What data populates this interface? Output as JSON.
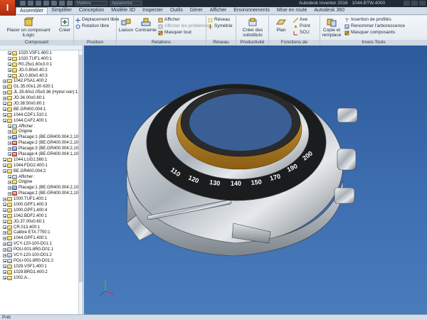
{
  "app": {
    "title_app": "Autodesk Inventor 2016",
    "title_file": "1044.BTW.4000"
  },
  "qat": {
    "material": "Matière",
    "appearance": "Apparence"
  },
  "tabs": [
    "Assembler",
    "Simplifier",
    "Conception",
    "Modèle 3D",
    "Inspecter",
    "Outils",
    "Gérer",
    "Afficher",
    "Environnements",
    "Mise en route",
    "Autodesk 360"
  ],
  "ribbon": {
    "composant": {
      "title": "Composant",
      "place": "Placer un composant iLogic",
      "create": "Créer"
    },
    "position": {
      "title": "Position",
      "free_move": "Déplacement libre",
      "free_rotate": "Rotation libre"
    },
    "relations": {
      "title": "Relations",
      "joint": "Liaison",
      "constraint": "Contrainte",
      "show": "Afficher",
      "show_problems": "Afficher les problèmes",
      "hide_all": "Masquer tout"
    },
    "reseau": {
      "title": "Réseau",
      "pattern": "Réseau",
      "mirror": "Symétrie"
    },
    "productivite": {
      "title": "Productivité",
      "substitutes": "Créer des substituts"
    },
    "fonctions": {
      "title": "Fonctions de construction",
      "plane": "Plan",
      "axis": "Axe",
      "point": "Point",
      "ucs": "SCU"
    },
    "inven_tools": {
      "title": "Inven-Tools",
      "copy_replace": "Copie et remplace",
      "insert_profiles": "Insertion de profilés",
      "rename_tree": "Renommer l'arborescence",
      "hide_components": "Masquer composants"
    }
  },
  "tree": [
    {
      "label": "1020.VSF1.400:1",
      "depth": 1,
      "icon": "yellow"
    },
    {
      "label": "1020.TUF1.400:1",
      "depth": 1,
      "icon": "yellow"
    },
    {
      "label": "R0.25x1.60x3.0:1",
      "depth": 1,
      "icon": "yellow"
    },
    {
      "label": "JO.0.80x0.40:2",
      "depth": 1,
      "icon": "yellow"
    },
    {
      "label": "JO.0.80x0.40:3",
      "depth": 1,
      "icon": "yellow"
    },
    {
      "label": "1042.PSA1.400:2",
      "depth": 0,
      "icon": "yellow"
    },
    {
      "label": "GL.35.00x1.20-920:1",
      "depth": 0,
      "icon": "yellow"
    },
    {
      "label": "JL.35.60x1.05x0.36 (Hytrel noir):1",
      "depth": 0,
      "icon": "yellow"
    },
    {
      "label": "JO.34.00x0.80:1",
      "depth": 0,
      "icon": "yellow"
    },
    {
      "label": "JO.38.50x0.80:1",
      "depth": 0,
      "icon": "yellow"
    },
    {
      "label": "BE.GR400.004:1",
      "depth": 0,
      "icon": "yellow"
    },
    {
      "label": "1044.CDF1.510:1",
      "depth": 0,
      "icon": "yellow"
    },
    {
      "label": "1044.CAF2.400:1",
      "depth": 0,
      "icon": "yellow"
    },
    {
      "label": "Afficher :",
      "depth": 1,
      "icon": "gray"
    },
    {
      "label": "Origine",
      "depth": 1,
      "icon": "yellow"
    },
    {
      "label": "Placage:1 (BE.GR400.004:2,1044",
      "depth": 1,
      "icon": "blue"
    },
    {
      "label": "Placage:2 (BE.GR400.004:2,1044",
      "depth": 1,
      "icon": "red"
    },
    {
      "label": "Placage:3 (BE.GR400.004:2,1044",
      "depth": 1,
      "icon": "blue"
    },
    {
      "label": "Placage:4 (BE.GR400.004:1,1044",
      "depth": 1,
      "icon": "red"
    },
    {
      "label": "1044.LUG1.560:1",
      "depth": 0,
      "icon": "yellow"
    },
    {
      "label": "1044.FDG2.400:1",
      "depth": 0,
      "icon": "yellow"
    },
    {
      "label": "BE.GR400.004:2",
      "depth": 0,
      "icon": "yellow"
    },
    {
      "label": "Afficher :",
      "depth": 1,
      "icon": "gray"
    },
    {
      "label": "Origine",
      "depth": 1,
      "icon": "yellow"
    },
    {
      "label": "Placage:1 (BE.GR400.004:2,104",
      "depth": 1,
      "icon": "blue"
    },
    {
      "label": "Placage:2 (BE.GR400.004:2,104",
      "depth": 1,
      "icon": "red"
    },
    {
      "label": "1000.TUF1.400:1",
      "depth": 0,
      "icon": "yellow"
    },
    {
      "label": "1000.GPF1.400:3",
      "depth": 0,
      "icon": "yellow"
    },
    {
      "label": "1000.GPF1.400:4",
      "depth": 0,
      "icon": "yellow"
    },
    {
      "label": "1042.BDF2.400:1",
      "depth": 0,
      "icon": "yellow"
    },
    {
      "label": "JO.37.00x0.60:1",
      "depth": 0,
      "icon": "yellow"
    },
    {
      "label": "CR.013.400:1",
      "depth": 0,
      "icon": "yellow"
    },
    {
      "label": "Calibre ETA 7750:1",
      "depth": 0,
      "icon": "yellow"
    },
    {
      "label": "1044.GPF1.400:1",
      "depth": 0,
      "icon": "yellow"
    },
    {
      "label": "VCY-120-100-D01:1",
      "depth": 0,
      "icon": "gray"
    },
    {
      "label": "POU-001-8R0-D01:1",
      "depth": 0,
      "icon": "gray"
    },
    {
      "label": "VCY-120-100-D01:2",
      "depth": 0,
      "icon": "gray"
    },
    {
      "label": "POU-001-8R0-D01:2",
      "depth": 0,
      "icon": "gray"
    },
    {
      "label": "1029.VSF1.400:1",
      "depth": 0,
      "icon": "yellow"
    },
    {
      "label": "1029.BRD1.400:2",
      "depth": 0,
      "icon": "yellow"
    },
    {
      "label": "1002.A...",
      "depth": 0,
      "icon": "yellow"
    }
  ],
  "viewport": {
    "bezel_numbers": [
      "110",
      "120",
      "130",
      "140",
      "150",
      "170",
      "190",
      "200"
    ]
  },
  "status": {
    "text": "Prêt"
  }
}
